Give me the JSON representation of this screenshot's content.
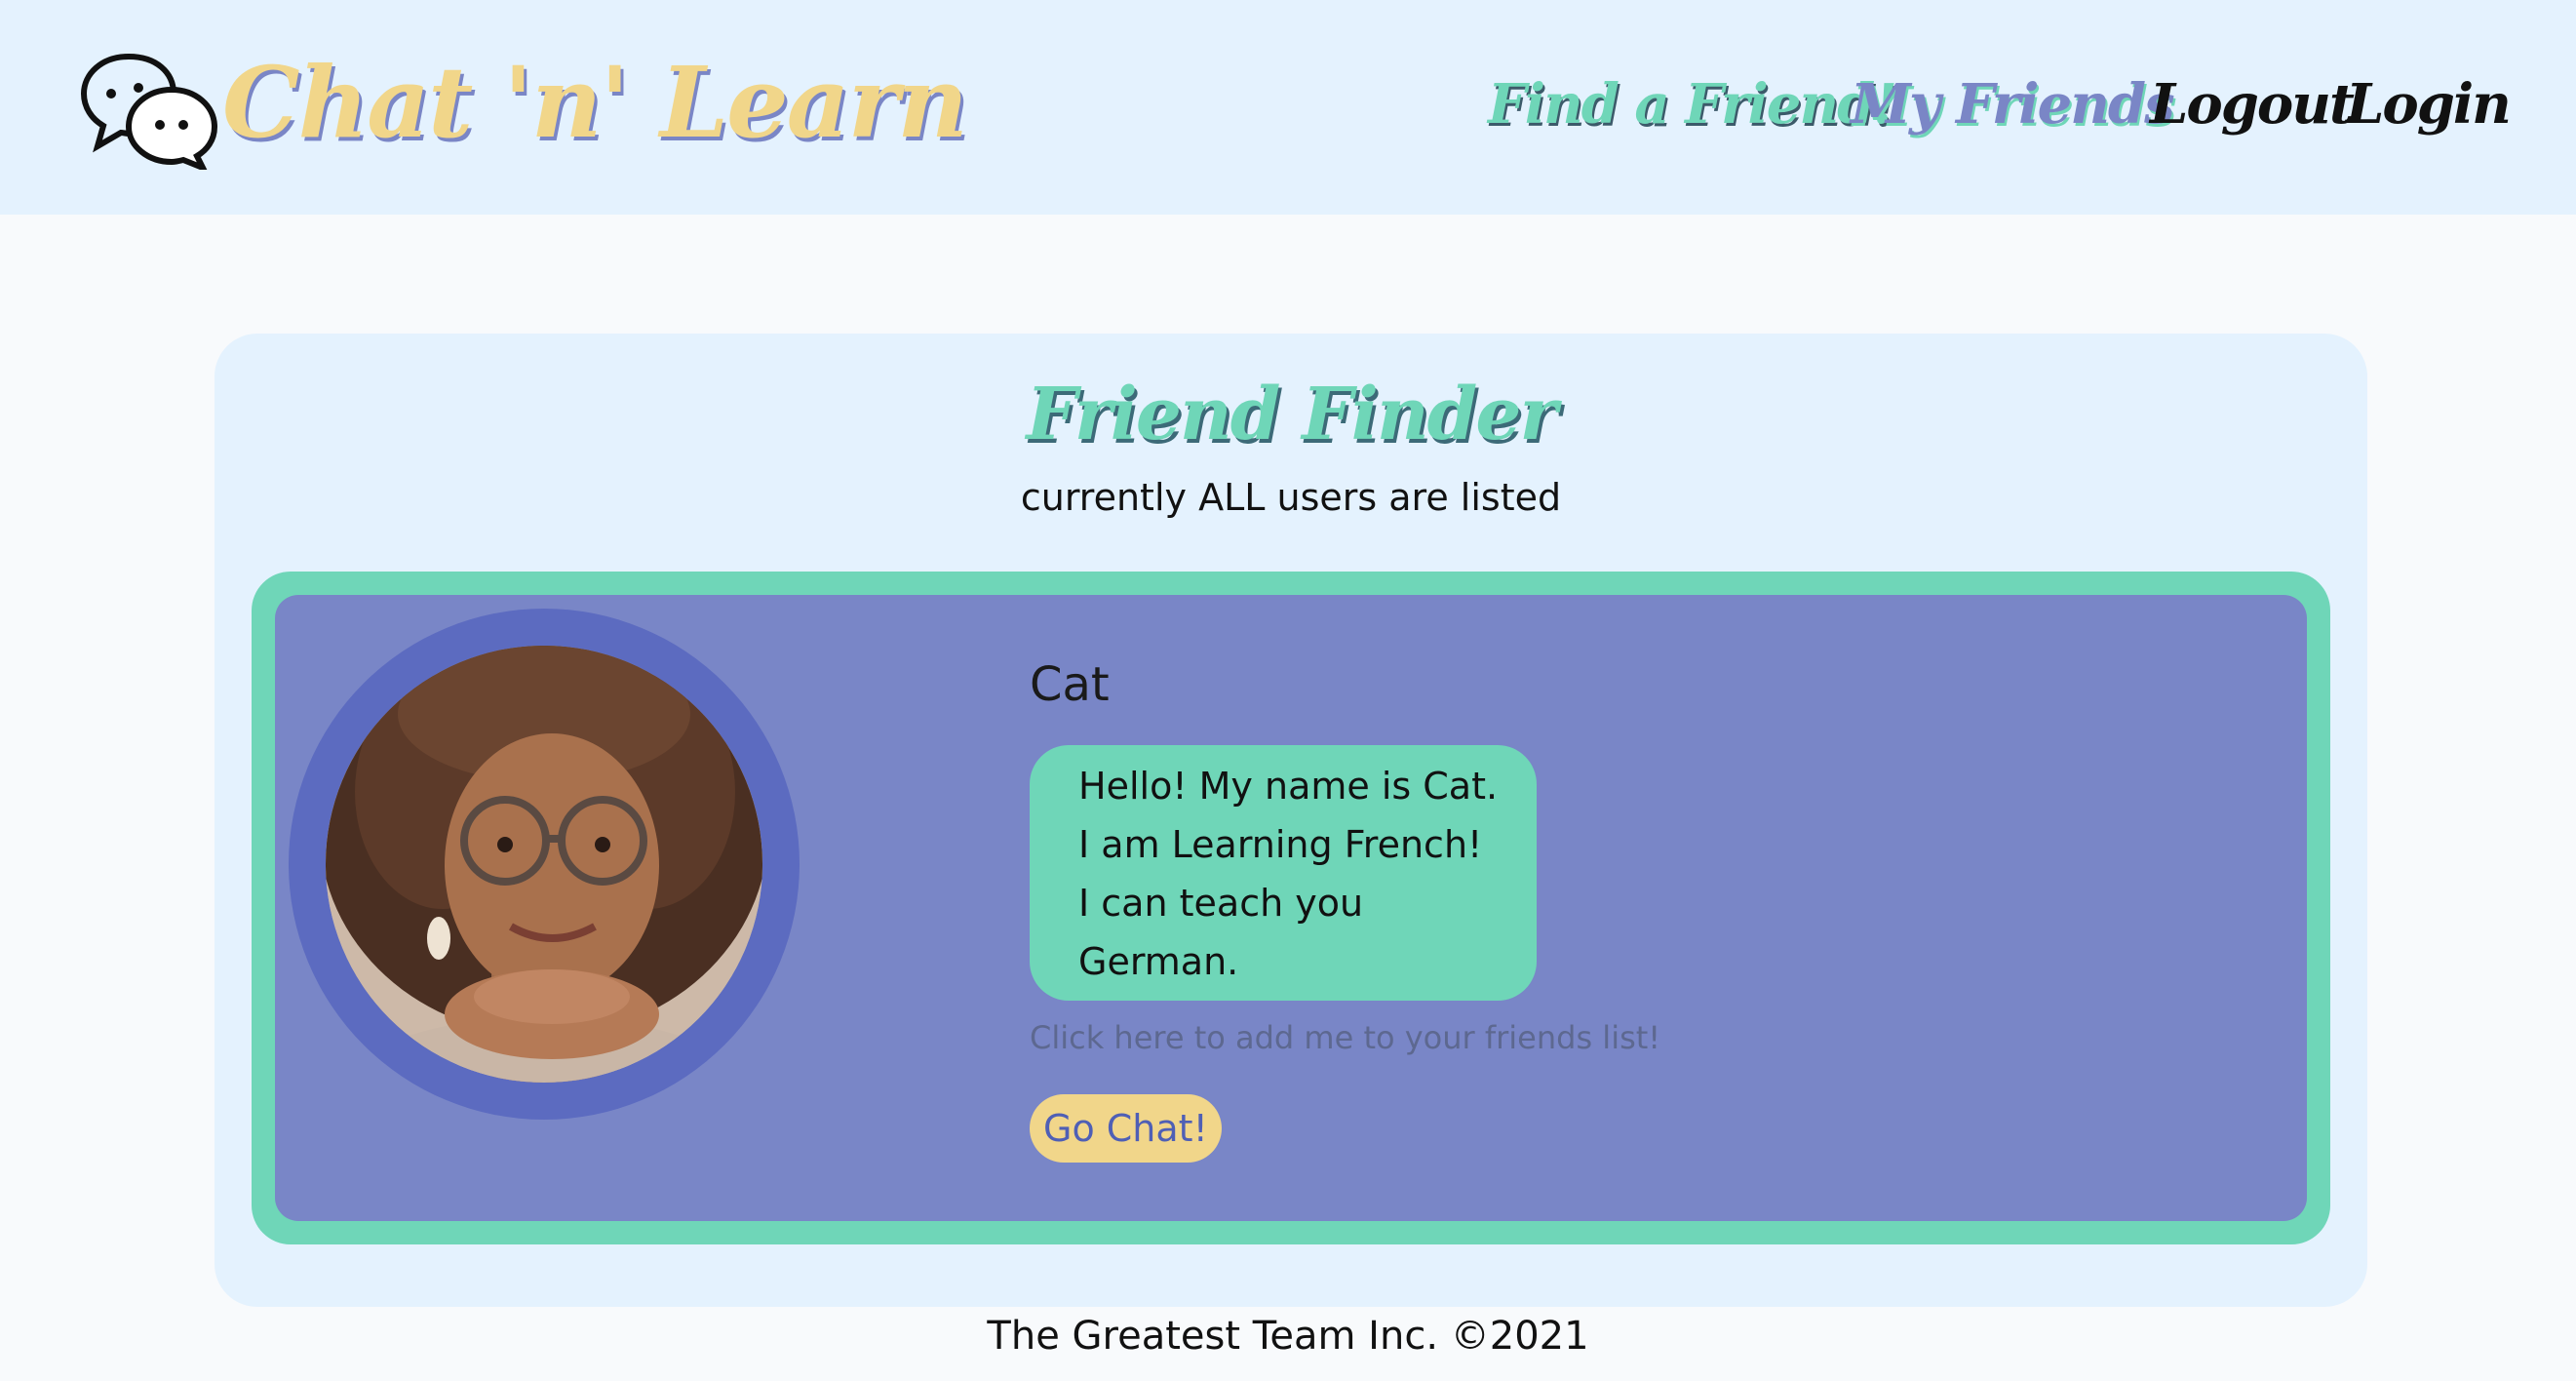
{
  "header": {
    "brand": "Chat 'n' Learn",
    "nav": {
      "find_friend": "Find a Friend!",
      "my_friends": "My Friends",
      "logout": "Logout",
      "login": "Login"
    },
    "logo_icon": "chat-bubbles-icon"
  },
  "main": {
    "title": "Friend Finder",
    "subtitle": "currently ALL users are listed",
    "cards": [
      {
        "name": "Cat",
        "bio": "Hello! My name is Cat.\nI am Learning French!\nI can teach you\nGerman.",
        "add_link": "Click here to add me to your friends list!",
        "chat_button": "Go Chat!"
      }
    ]
  },
  "footer": {
    "text": "The Greatest Team Inc. ©2021"
  },
  "colors": {
    "header_bg": "#e4f2fe",
    "brand_yellow": "#f1d68a",
    "accent_green": "#6fd6b8",
    "accent_purple": "#7986c7",
    "ring_purple": "#5c6bc0"
  }
}
